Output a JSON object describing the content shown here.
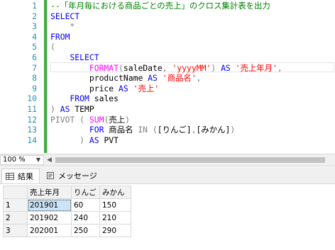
{
  "editor": {
    "lines": [
      {
        "n": "1",
        "parts": [
          {
            "c": "cmt",
            "t": "--「年月毎における商品ごとの売上」のクロス集計表を出力"
          }
        ]
      },
      {
        "n": "2",
        "parts": [
          {
            "c": "kw",
            "t": "SELECT"
          }
        ]
      },
      {
        "n": "3",
        "parts": [
          {
            "c": "gray",
            "t": "    *"
          }
        ]
      },
      {
        "n": "4",
        "parts": [
          {
            "c": "kw",
            "t": "FROM"
          }
        ]
      },
      {
        "n": "5",
        "parts": [
          {
            "c": "gray",
            "t": "("
          }
        ]
      },
      {
        "n": "6",
        "parts": [
          {
            "c": "kw",
            "t": "    SELECT"
          }
        ]
      },
      {
        "n": "7",
        "parts": [
          {
            "c": "fn",
            "t": "        FORMAT"
          },
          {
            "c": "gray",
            "t": "("
          },
          {
            "c": "plain",
            "t": "saleDate"
          },
          {
            "c": "gray",
            "t": ", "
          },
          {
            "c": "str",
            "t": "'yyyyMM'"
          },
          {
            "c": "gray",
            "t": ") "
          },
          {
            "c": "kw",
            "t": "AS "
          },
          {
            "c": "str",
            "t": "'売上年月'"
          },
          {
            "c": "gray",
            "t": ","
          }
        ]
      },
      {
        "n": "8",
        "parts": [
          {
            "c": "plain",
            "t": "        productName "
          },
          {
            "c": "kw",
            "t": "AS "
          },
          {
            "c": "str",
            "t": "'商品名'"
          },
          {
            "c": "gray",
            "t": ","
          }
        ]
      },
      {
        "n": "9",
        "parts": [
          {
            "c": "plain",
            "t": "        price "
          },
          {
            "c": "kw",
            "t": "AS "
          },
          {
            "c": "str",
            "t": "'売上'"
          }
        ]
      },
      {
        "n": "10",
        "parts": [
          {
            "c": "kw",
            "t": "    FROM "
          },
          {
            "c": "plain",
            "t": "sales"
          }
        ]
      },
      {
        "n": "11",
        "parts": [
          {
            "c": "gray",
            "t": ") "
          },
          {
            "c": "kw",
            "t": "AS "
          },
          {
            "c": "plain",
            "t": "TEMP"
          }
        ]
      },
      {
        "n": "12",
        "parts": [
          {
            "c": "gray",
            "t": "PIVOT ( "
          },
          {
            "c": "fn",
            "t": "SUM"
          },
          {
            "c": "gray",
            "t": "("
          },
          {
            "c": "plain",
            "t": "売上"
          },
          {
            "c": "gray",
            "t": ")"
          }
        ]
      },
      {
        "n": "13",
        "parts": [
          {
            "c": "kw",
            "t": "        FOR "
          },
          {
            "c": "plain",
            "t": "商品名 "
          },
          {
            "c": "gray",
            "t": "IN ("
          },
          {
            "c": "plain",
            "t": "[りんご]"
          },
          {
            "c": "gray",
            "t": ","
          },
          {
            "c": "plain",
            "t": "[みかん]"
          },
          {
            "c": "gray",
            "t": ")"
          }
        ]
      },
      {
        "n": "14",
        "parts": [
          {
            "c": "gray",
            "t": "      ) "
          },
          {
            "c": "kw",
            "t": "AS "
          },
          {
            "c": "plain",
            "t": "PVT"
          }
        ]
      }
    ]
  },
  "zoom": {
    "value": "100 %"
  },
  "tabs": [
    {
      "label": "結果",
      "active": true
    },
    {
      "label": "メッセージ",
      "active": false
    }
  ],
  "grid": {
    "columns": [
      "売上年月",
      "りんご",
      "みかん"
    ],
    "rows": [
      {
        "num": "1",
        "cells": [
          "201901",
          "60",
          "150"
        ]
      },
      {
        "num": "2",
        "cells": [
          "201902",
          "240",
          "210"
        ]
      },
      {
        "num": "3",
        "cells": [
          "202001",
          "250",
          "290"
        ]
      }
    ]
  }
}
